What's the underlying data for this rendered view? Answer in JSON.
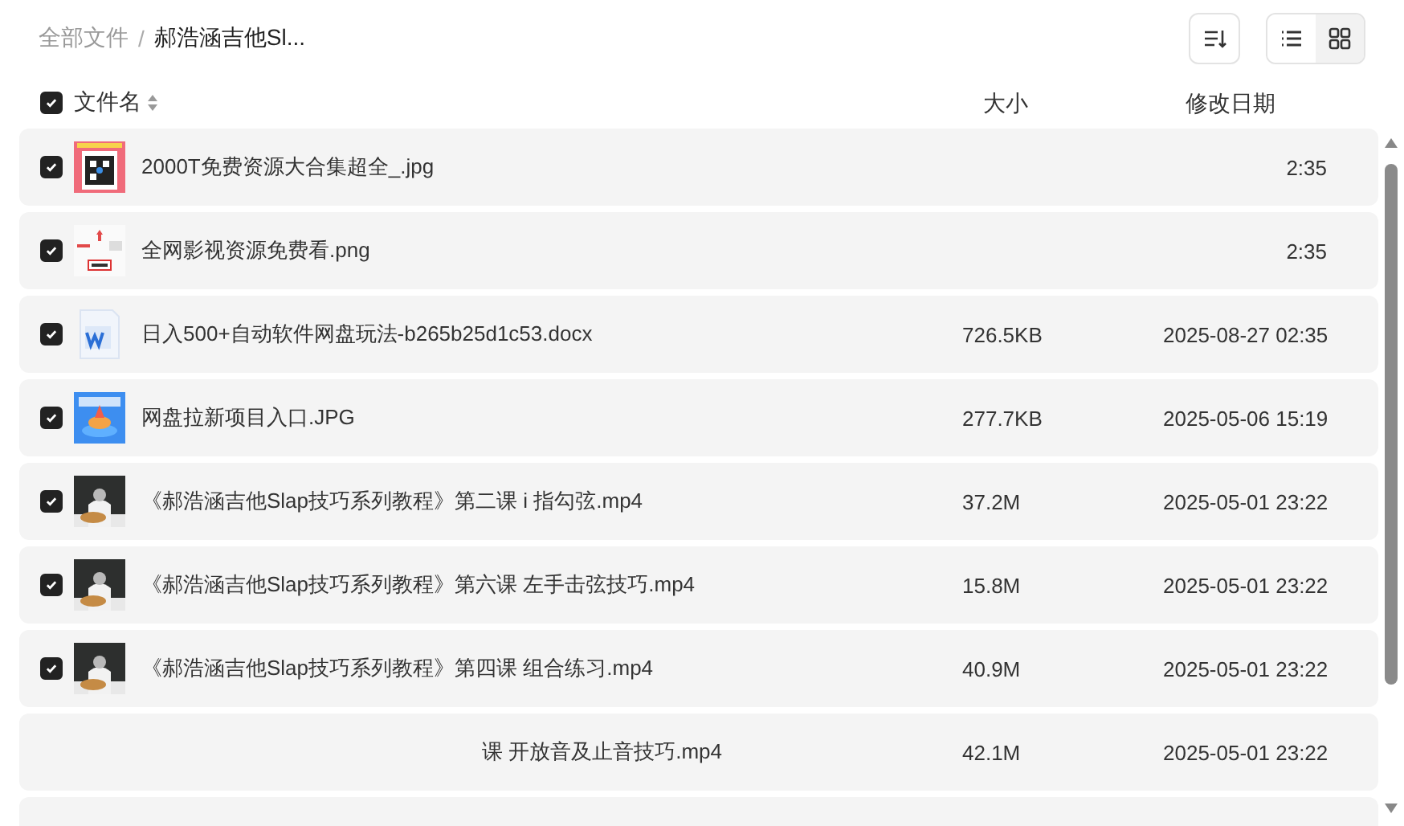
{
  "breadcrumb": [
    {
      "label": "全部文件",
      "current": false
    },
    {
      "label": "郝浩涵吉他Sl...",
      "current": true
    }
  ],
  "breadcrumb_separator": "/",
  "toolbar": {
    "view_modes": [
      {
        "kind": "list",
        "selected": false
      },
      {
        "kind": "grid",
        "selected": true
      }
    ]
  },
  "header": {
    "checked": true,
    "name": "文件名",
    "size": "大小",
    "date": "修改日期"
  },
  "rows": [
    {
      "checked": true,
      "kind": "qr",
      "name": "2000T免费资源大合集超全_.jpg",
      "date": "2:35"
    },
    {
      "checked": true,
      "kind": "poster",
      "name": "全网影视资源免费看.png",
      "date": "2:35"
    },
    {
      "checked": true,
      "kind": "doc",
      "name": "日入500+自动软件网盘玩法-b265b25d1c53.docx",
      "size": "726.5KB",
      "date": "2025-08-27 02:35"
    },
    {
      "checked": true,
      "kind": "promo",
      "name": "网盘拉新项目入口.JPG",
      "size": "277.7KB",
      "date": "2025-05-06 15:19"
    },
    {
      "checked": true,
      "kind": "video",
      "name": "《郝浩涵吉他Slap技巧系列教程》第二课 i 指勾弦.mp4",
      "size": "37.2M",
      "date": "2025-05-01 23:22"
    },
    {
      "checked": true,
      "kind": "video",
      "name": "《郝浩涵吉他Slap技巧系列教程》第六课 左手击弦技巧.mp4",
      "size": "15.8M",
      "date": "2025-05-01 23:22"
    },
    {
      "checked": true,
      "kind": "video",
      "name": "《郝浩涵吉他Slap技巧系列教程》第四课 组合练习.mp4",
      "size": "40.9M",
      "date": "2025-05-01 23:22"
    },
    {
      "name": "课 开放音及止音技巧.mp4",
      "size": "42.1M",
      "date": "2025-05-01 23:22"
    }
  ]
}
